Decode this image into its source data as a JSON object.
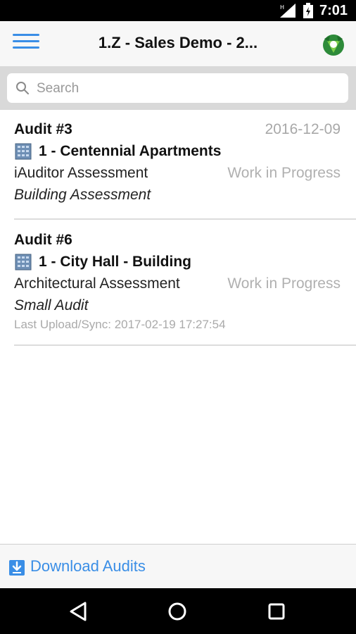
{
  "status_bar": {
    "time": "7:01",
    "signal_icon": "signal-icon",
    "battery_icon": "battery-icon"
  },
  "app_bar": {
    "title": "1.Z - Sales Demo - 2...",
    "menu_icon": "hamburger-menu-icon",
    "logo_icon": "app-logo-icon",
    "accent_color": "#3a8ee6"
  },
  "search": {
    "placeholder": "Search",
    "value": ""
  },
  "audits": [
    {
      "title": "Audit #3",
      "date": "2016-12-09",
      "site": "1 - Centennial Apartments",
      "assessment_type": "iAuditor Assessment",
      "status": "Work in Progress",
      "description": "Building Assessment",
      "sync": ""
    },
    {
      "title": "Audit #6",
      "date": "",
      "site": "1 - City Hall - Building",
      "assessment_type": "Architectural Assessment",
      "status": "Work in Progress",
      "description": "Small Audit",
      "sync": "Last Upload/Sync: 2017-02-19 17:27:54"
    }
  ],
  "bottom_bar": {
    "download_label": "Download Audits",
    "download_icon": "download-icon"
  },
  "nav_bar": {
    "back_icon": "back-icon",
    "home_icon": "home-icon",
    "recents_icon": "recents-icon"
  }
}
